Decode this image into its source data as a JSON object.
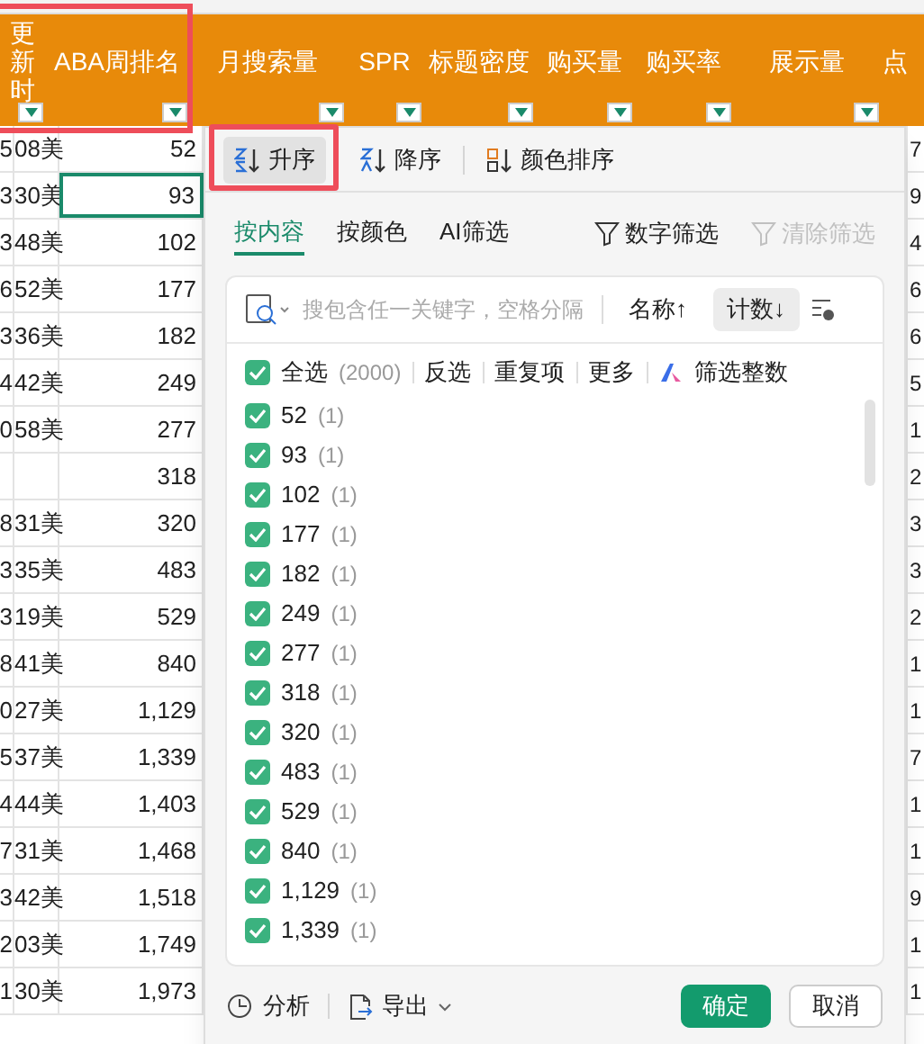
{
  "columns": [
    {
      "label": "更新时",
      "filter": true,
      "highlighted": true
    },
    {
      "label": "ABA周排名",
      "filter": true,
      "highlighted": true
    },
    {
      "label": "月搜索量",
      "filter": true,
      "highlighted": false
    },
    {
      "label": "SPR",
      "filter": true,
      "highlighted": false
    },
    {
      "label": "标题密度",
      "filter": true,
      "highlighted": false
    },
    {
      "label": "购买量",
      "filter": true,
      "highlighted": false
    },
    {
      "label": "购买率",
      "filter": true,
      "highlighted": false
    },
    {
      "label": "展示量",
      "filter": true,
      "highlighted": false
    },
    {
      "label": "点",
      "filter": false,
      "highlighted": false
    }
  ],
  "rows": [
    {
      "column_1": "5",
      "column_2": "08美",
      "rank": "52",
      "column_4": "7",
      "selected": false
    },
    {
      "column_1": "3",
      "column_2": "30美",
      "rank": "93",
      "column_4": "9",
      "selected": true
    },
    {
      "column_1": "3",
      "column_2": "48美",
      "rank": "102",
      "column_4": "4",
      "selected": false
    },
    {
      "column_1": "6",
      "column_2": "52美",
      "rank": "177",
      "column_4": "6",
      "selected": false
    },
    {
      "column_1": "3",
      "column_2": "36美",
      "rank": "182",
      "column_4": "6",
      "selected": false
    },
    {
      "column_1": "4",
      "column_2": "42美",
      "rank": "249",
      "column_4": "5",
      "selected": false
    },
    {
      "column_1": "0",
      "column_2": "58美",
      "rank": "277",
      "column_4": "1",
      "selected": false
    },
    {
      "rank": "318",
      "column_4": "2",
      "selected": false
    },
    {
      "column_1": "8",
      "column_2": "31美",
      "rank": "320",
      "column_4": "3",
      "selected": false
    },
    {
      "column_1": "3",
      "column_2": "35美",
      "rank": "483",
      "column_4": "3",
      "selected": false
    },
    {
      "column_1": "3",
      "column_2": "19美",
      "rank": "529",
      "column_4": "2",
      "selected": false
    },
    {
      "column_1": "8",
      "column_2": "41美",
      "rank": "840",
      "column_4": "1",
      "selected": false
    },
    {
      "column_1": "0",
      "column_2": "27美",
      "rank": "1,129",
      "column_4": "1",
      "selected": false
    },
    {
      "column_1": "5",
      "column_2": "37美",
      "rank": "1,339",
      "column_4": "7",
      "selected": false
    },
    {
      "column_1": "4",
      "column_2": "44美",
      "rank": "1,403",
      "column_4": "1",
      "selected": false
    },
    {
      "column_1": "7",
      "column_2": "31美",
      "rank": "1,468",
      "column_4": "1",
      "selected": false
    },
    {
      "column_1": "3",
      "column_2": "42美",
      "rank": "1,518",
      "column_4": "9",
      "selected": false
    },
    {
      "column_1": "2",
      "column_2": "03美",
      "rank": "1,749",
      "column_4": "1",
      "selected": false
    },
    {
      "column_1": "1",
      "column_2": "30美",
      "rank": "1,973",
      "column_4": "1",
      "selected": false
    }
  ],
  "filter_panel": {
    "sort_buttons": [
      {
        "label": "升序",
        "kind": "asc",
        "selected": true
      },
      {
        "label": "降序",
        "kind": "desc",
        "selected": false
      },
      {
        "label": "颜色排序",
        "kind": "color",
        "selected": false
      }
    ],
    "tabs": [
      {
        "label": "按内容",
        "selected": true
      },
      {
        "label": "按颜色",
        "selected": false
      },
      {
        "label": "AI筛选",
        "selected": false
      }
    ],
    "tools": [
      {
        "label": "数字筛选",
        "disabled": false
      },
      {
        "label": "清除筛选",
        "disabled": true
      }
    ],
    "search": {
      "placeholder": "搜包含任一关键字，空格分隔"
    },
    "order_buttons": [
      {
        "label": "名称↑",
        "selected": false
      },
      {
        "label": "计数↓",
        "selected": true
      }
    ],
    "select_all": {
      "label": "全选",
      "count": "(2000)",
      "checked": true
    },
    "actions": [
      "反选",
      "重复项",
      "更多"
    ],
    "ai_action": "筛选整数",
    "values": [
      {
        "label": "52",
        "count": "(1)",
        "checked": true
      },
      {
        "label": "93",
        "count": "(1)",
        "checked": true
      },
      {
        "label": "102",
        "count": "(1)",
        "checked": true
      },
      {
        "label": "177",
        "count": "(1)",
        "checked": true
      },
      {
        "label": "182",
        "count": "(1)",
        "checked": true
      },
      {
        "label": "249",
        "count": "(1)",
        "checked": true
      },
      {
        "label": "277",
        "count": "(1)",
        "checked": true
      },
      {
        "label": "318",
        "count": "(1)",
        "checked": true
      },
      {
        "label": "320",
        "count": "(1)",
        "checked": true
      },
      {
        "label": "483",
        "count": "(1)",
        "checked": true
      },
      {
        "label": "529",
        "count": "(1)",
        "checked": true
      },
      {
        "label": "840",
        "count": "(1)",
        "checked": true
      },
      {
        "label": "1,129",
        "count": "(1)",
        "checked": true
      },
      {
        "label": "1,339",
        "count": "(1)",
        "checked": true
      }
    ],
    "footer": {
      "analyze": "分析",
      "export": "导出",
      "confirm": "确定",
      "cancel": "取消"
    }
  }
}
